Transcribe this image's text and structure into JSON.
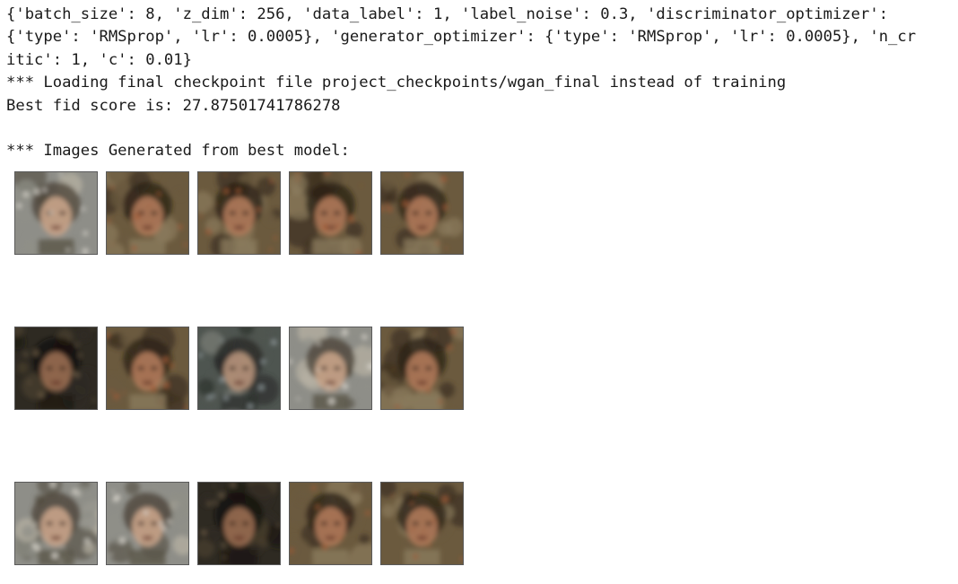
{
  "output": {
    "config_line_1": "{'batch_size': 8, 'z_dim': 256, 'data_label': 1, 'label_noise': 0.3, 'discriminator_optimizer':",
    "config_line_2": "{'type': 'RMSprop', 'lr': 0.0005}, 'generator_optimizer': {'type': 'RMSprop', 'lr': 0.0005}, 'n_cr",
    "config_line_3": "itic': 1, 'c': 0.01}",
    "loading_line": "*** Loading final checkpoint file project_checkpoints/wgan_final instead of training",
    "fid_line": "Best fid score is: 27.87501741786278",
    "images_heading": "*** Images Generated from best model:"
  },
  "images": {
    "rows": [
      {
        "tones": [
          "pale",
          "warm",
          "warm",
          "warm",
          "warm"
        ]
      },
      {
        "tones": [
          "dark",
          "warm",
          "cool",
          "pale",
          "warm"
        ]
      },
      {
        "tones": [
          "pale",
          "pale",
          "dark",
          "warm",
          "warm"
        ]
      }
    ]
  }
}
